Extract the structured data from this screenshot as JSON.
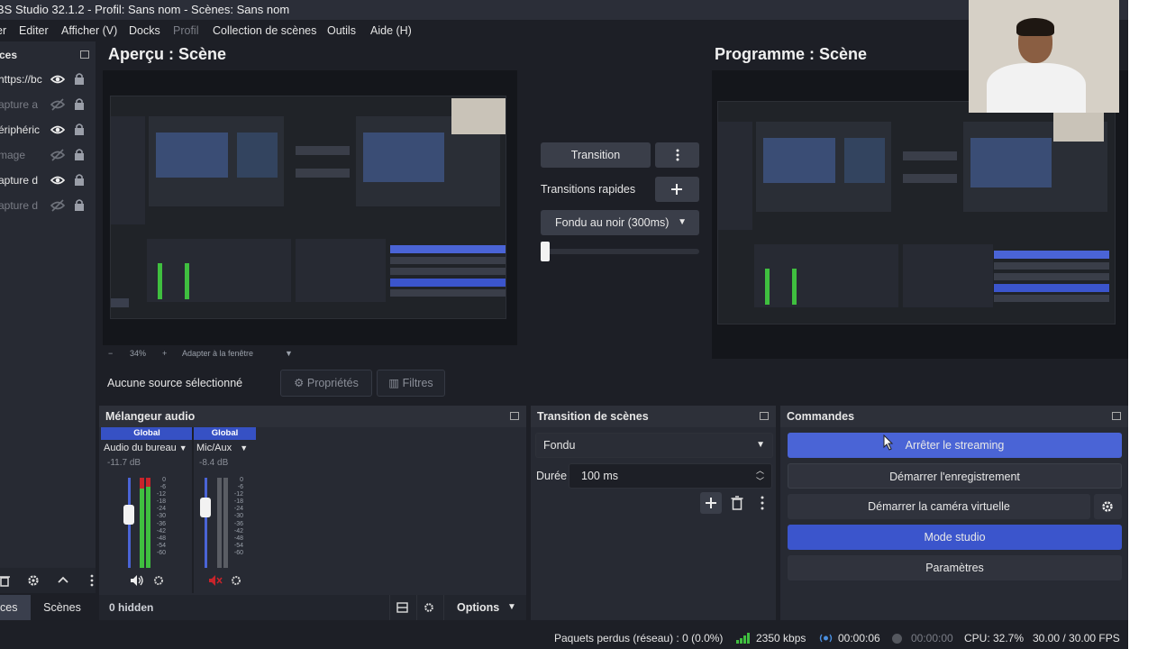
{
  "window": {
    "title": "BS Studio 32.1.2 - Profil: Sans nom - Scènes: Sans nom"
  },
  "menu": [
    {
      "label": "er",
      "dim": false
    },
    {
      "label": "Editer",
      "dim": false
    },
    {
      "label": "Afficher (V)",
      "dim": false
    },
    {
      "label": "Docks",
      "dim": false
    },
    {
      "label": "Profil",
      "dim": true
    },
    {
      "label": "Collection de scènes",
      "dim": false
    },
    {
      "label": "Outils",
      "dim": false
    },
    {
      "label": "Aide (H)",
      "dim": false
    }
  ],
  "sources": {
    "header": "ces",
    "items": [
      {
        "label": "https://bc",
        "visible": true
      },
      {
        "label": "apture a",
        "visible": false
      },
      {
        "label": "ériphéric",
        "visible": true
      },
      {
        "label": "mage",
        "visible": false
      },
      {
        "label": "apture d",
        "visible": true
      },
      {
        "label": "apture d",
        "visible": false
      }
    ],
    "tab_sources": "ces",
    "tab_scenes": "Scènes"
  },
  "preview": {
    "title": "Aperçu : Scène",
    "zoom": "34%",
    "fit": "Adapter à la fenêtre"
  },
  "program": {
    "title": "Programme : Scène"
  },
  "transition_panel": {
    "transition_button": "Transition",
    "quick_label": "Transitions rapides",
    "quick_select": "Fondu au noir (300ms)",
    "tbar_level": 0.0
  },
  "props_bar": {
    "no_source": "Aucune source sélectionné",
    "properties": "Propriétés",
    "filters": "Filtres"
  },
  "audio_mixer": {
    "title": "Mélangeur audio",
    "channels": [
      {
        "global": "Global",
        "name": "Audio du bureau",
        "db": "-11.7 dB",
        "fader": 0.72
      },
      {
        "global": "Global",
        "name": "Mic/Aux",
        "db": "-8.4 dB",
        "fader": 0.78
      }
    ],
    "scale": [
      "0",
      "-6",
      "-12",
      "-18",
      "-24",
      "-30",
      "-36",
      "-42",
      "-48",
      "-54",
      "-60"
    ],
    "hidden": "0 hidden",
    "options": "Options"
  },
  "scene_transitions": {
    "title": "Transition de scènes",
    "selected": "Fondu",
    "duration_label": "Durée",
    "duration_value": "100 ms"
  },
  "controls": {
    "title": "Commandes",
    "stop_stream": "Arrêter le streaming",
    "start_record": "Démarrer l'enregistrement",
    "start_vcam": "Démarrer la caméra virtuelle",
    "studio_mode": "Mode studio",
    "settings": "Paramètres"
  },
  "status": {
    "dropped": "Paquets perdus (réseau) : 0 (0.0%)",
    "bitrate": "2350 kbps",
    "stream_time": "00:00:06",
    "rec_time": "00:00:00",
    "cpu": "CPU: 32.7%",
    "fps": "30.00 / 30.00 FPS"
  },
  "colors": {
    "accent": "#4a64d6",
    "panel": "#272a33",
    "bg": "#1d1f26",
    "meter_green": "#3fbf3f",
    "meter_red": "#c8242b"
  }
}
